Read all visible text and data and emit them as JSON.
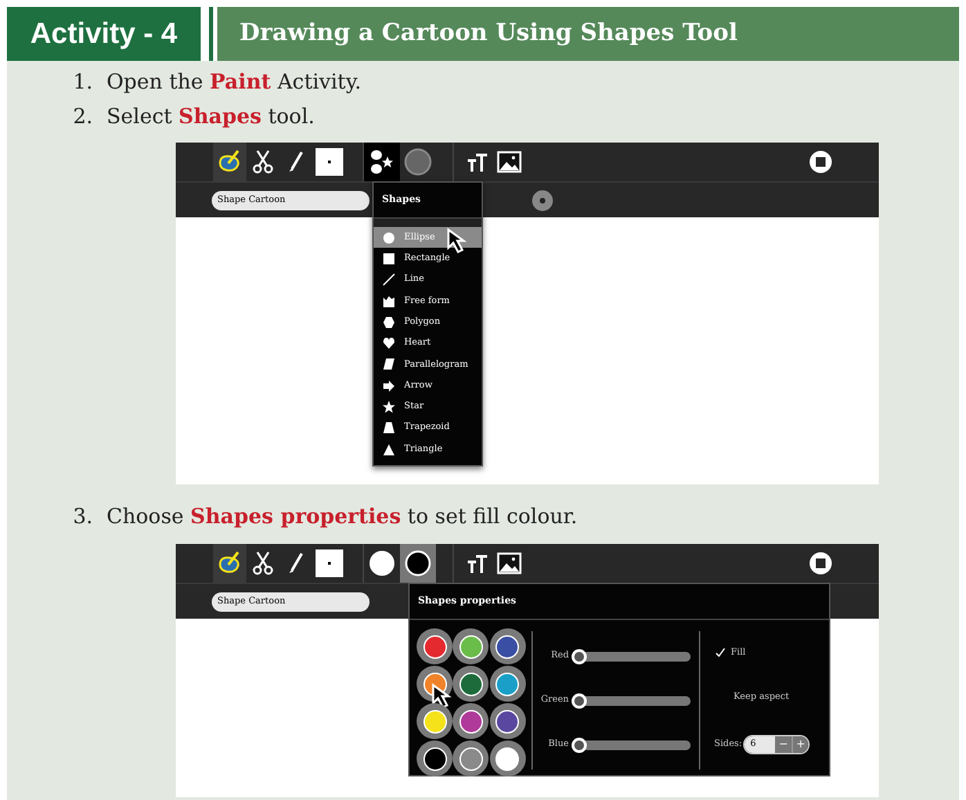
{
  "header": {
    "activity_label": "Activity - 4",
    "title": "Drawing a Cartoon Using Shapes Tool"
  },
  "steps": [
    {
      "number": "1.",
      "text": "Open the **Paint** Activity."
    },
    {
      "number": "2.",
      "text": "Select **Shapes** tool.",
      "screenshot": {
        "tools": [
          {
            "kind": "activity",
            "selected": true
          },
          {
            "kind": "scissors",
            "selected": false
          },
          {
            "kind": "brush",
            "selected": false
          },
          {
            "kind": "canvas",
            "selected": false
          },
          {
            "kind": "shapes",
            "selected": true
          },
          {
            "kind": "grey-circle",
            "selected": false
          },
          {
            "kind": "text",
            "selected": false
          },
          {
            "kind": "image",
            "selected": false
          },
          {
            "kind": "stop",
            "selected": false
          }
        ],
        "title_field": "Shape Cartoon",
        "menu": {
          "kind": "shapes",
          "title": "Shapes",
          "items": [
            {
              "label": "Ellipse",
              "kind": "ellipse",
              "selected": true
            },
            {
              "label": "Rectangle",
              "kind": "rectangle",
              "selected": false
            },
            {
              "label": "Line",
              "kind": "line",
              "selected": false
            },
            {
              "label": "Free form",
              "kind": "freeform",
              "selected": false
            },
            {
              "label": "Polygon",
              "kind": "polygon",
              "selected": false
            },
            {
              "label": "Heart",
              "kind": "heart",
              "selected": false
            },
            {
              "label": "Parallelogram",
              "kind": "parallelogram",
              "selected": false
            },
            {
              "label": "Arrow",
              "kind": "arrow",
              "selected": false
            },
            {
              "label": "Star",
              "kind": "star",
              "selected": false
            },
            {
              "label": "Trapezoid",
              "kind": "trapezoid",
              "selected": false
            },
            {
              "label": "Triangle",
              "kind": "triangle",
              "selected": false
            }
          ]
        }
      }
    },
    {
      "number": "3.",
      "text": "Choose **Shapes properties** to set fill colour.",
      "screenshot": {
        "tools": [
          {
            "kind": "activity",
            "selected": true
          },
          {
            "kind": "scissors",
            "selected": false
          },
          {
            "kind": "brush",
            "selected": false
          },
          {
            "kind": "canvas",
            "selected": false
          },
          {
            "kind": "white-circle",
            "selected": false
          },
          {
            "kind": "black-circle",
            "selected": true
          },
          {
            "kind": "text",
            "selected": false
          },
          {
            "kind": "image",
            "selected": false
          },
          {
            "kind": "stop",
            "selected": false
          }
        ],
        "title_field": "Shape Cartoon",
        "menu": {
          "kind": "properties",
          "title": "Shapes properties",
          "swatches": [
            {
              "color": "#e52a2f",
              "selected": false
            },
            {
              "color": "#6bbd4a",
              "selected": false
            },
            {
              "color": "#3a4fa3",
              "selected": false
            },
            {
              "color": "#f0832a",
              "selected": true
            },
            {
              "color": "#1d6b3a",
              "selected": false
            },
            {
              "color": "#1aa0c8",
              "selected": false
            },
            {
              "color": "#f5e21b",
              "selected": false
            },
            {
              "color": "#b03a9a",
              "selected": false
            },
            {
              "color": "#5a48a0",
              "selected": false
            },
            {
              "color": "#000000",
              "selected": false
            },
            {
              "color": "#8a8a8a",
              "selected": false
            },
            {
              "color": "#ffffff",
              "selected": false
            }
          ],
          "sliders": [
            {
              "label": "Red",
              "level": 0
            },
            {
              "label": "Green",
              "level": 0
            },
            {
              "label": "Blue",
              "level": 0
            }
          ],
          "fill": {
            "label": "Fill",
            "checked": true
          },
          "keep_aspect": "Keep aspect",
          "sides": {
            "label": "Sides:",
            "value": "6",
            "minus": "−",
            "plus": "+"
          }
        }
      }
    }
  ]
}
